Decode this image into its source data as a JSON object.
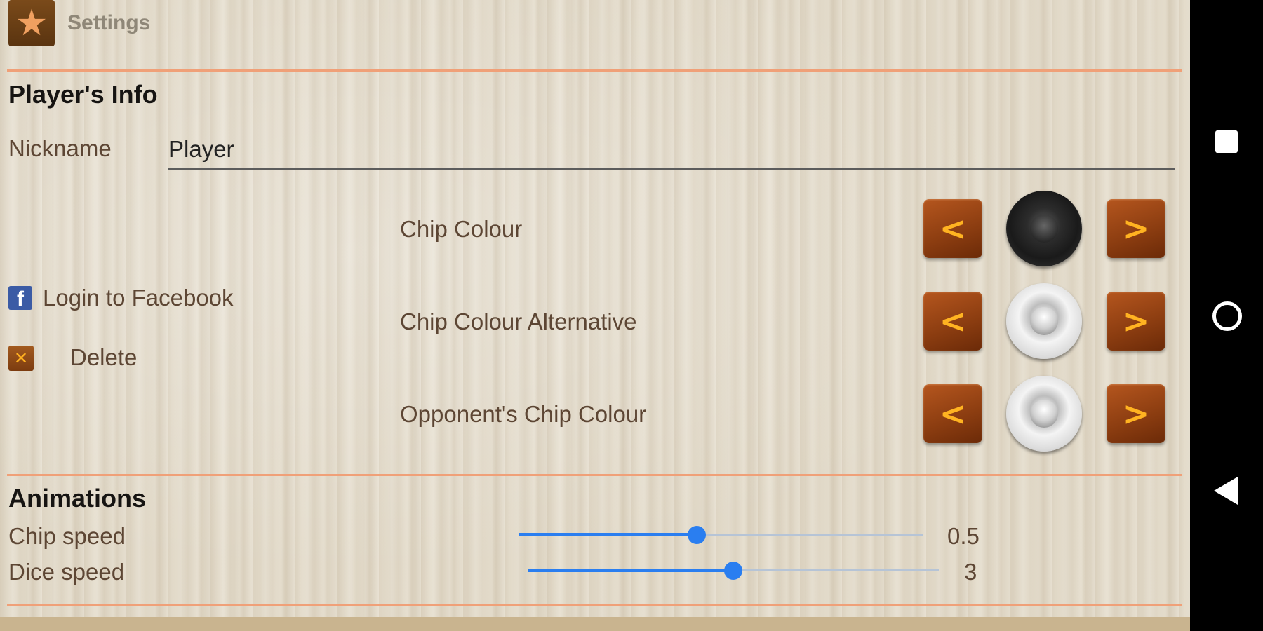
{
  "app": {
    "title": "Settings",
    "icon": "star-icon"
  },
  "players_info": {
    "title": "Player's Info",
    "nickname_label": "Nickname",
    "nickname_value": "Player",
    "facebook_label": "Login to Facebook",
    "delete_label": "Delete",
    "chip_rows": [
      {
        "label": "Chip Colour",
        "chip": "black"
      },
      {
        "label": "Chip Colour Alternative",
        "chip": "white"
      },
      {
        "label": "Opponent's Chip Colour",
        "chip": "white"
      }
    ],
    "prev_symbol": "<",
    "next_symbol": ">"
  },
  "animations": {
    "title": "Animations",
    "sliders": [
      {
        "label": "Chip speed",
        "value": "0.5",
        "fraction": 0.44
      },
      {
        "label": "Dice speed",
        "value": "3",
        "fraction": 0.5
      }
    ]
  },
  "colors": {
    "divider": "#f0a078",
    "slider": "#2a7ef0",
    "button": "#8a3c10"
  },
  "icons": {
    "facebook": "facebook-icon",
    "delete": "delete-icon",
    "nav_recent": "recent-apps-icon",
    "nav_home": "home-icon",
    "nav_back": "back-icon"
  }
}
